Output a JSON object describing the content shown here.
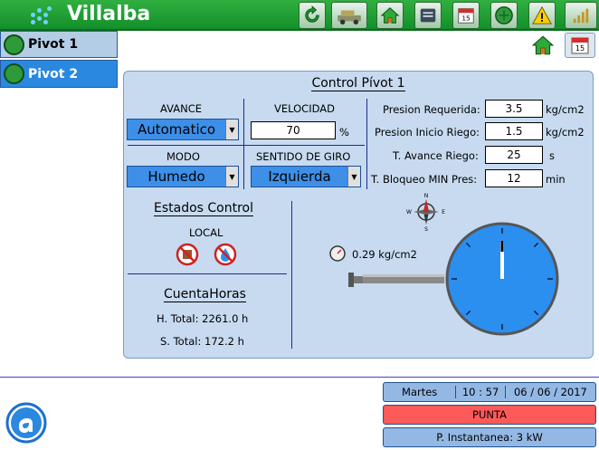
{
  "header": {
    "title": "Villalba",
    "calendar_day": "15"
  },
  "sidebar": {
    "items": [
      {
        "label": "Pivot 1"
      },
      {
        "label": "Pivot 2"
      }
    ]
  },
  "corner": {
    "calendar_day": "15"
  },
  "control": {
    "title": "Control Pívot 1",
    "avance_label": "AVANCE",
    "avance_value": "Automatico",
    "velocidad_label": "VELOCIDAD",
    "velocidad_value": "70",
    "velocidad_unit": "%",
    "modo_label": "MODO",
    "modo_value": "Humedo",
    "sentido_label": "SENTIDO DE GIRO",
    "sentido_value": "Izquierda",
    "params": [
      {
        "label": "Presion Requerida:",
        "value": "3.5",
        "unit": "kg/cm2"
      },
      {
        "label": "Presion Inicio Riego:",
        "value": "1.5",
        "unit": "kg/cm2"
      },
      {
        "label": "T. Avance Riego:",
        "value": "25",
        "unit": "s"
      },
      {
        "label": "T. Bloqueo MIN Pres:",
        "value": "12",
        "unit": "min"
      }
    ],
    "estados_title": "Estados Control",
    "estados_mode": "LOCAL",
    "cuentahoras_title": "CuentaHoras",
    "h_total": "H. Total: 2261.0 h",
    "s_total": "S. Total: 172.2 h",
    "pressure_reading": "0.29 kg/cm2",
    "compass": {
      "n": "N",
      "s": "S",
      "e": "E",
      "w": "W"
    }
  },
  "status": {
    "day": "Martes",
    "time": "10 : 57",
    "date": "06 / 06 / 2017",
    "tariff": "PUNTA",
    "power": "P. Instantanea: 3 kW"
  },
  "colors": {
    "topbar": "#1a9a30",
    "panel": "#c7daf0",
    "combo": "#3d8fe8",
    "gauge": "#2b8ff0",
    "alert": "#ff5a5a"
  }
}
